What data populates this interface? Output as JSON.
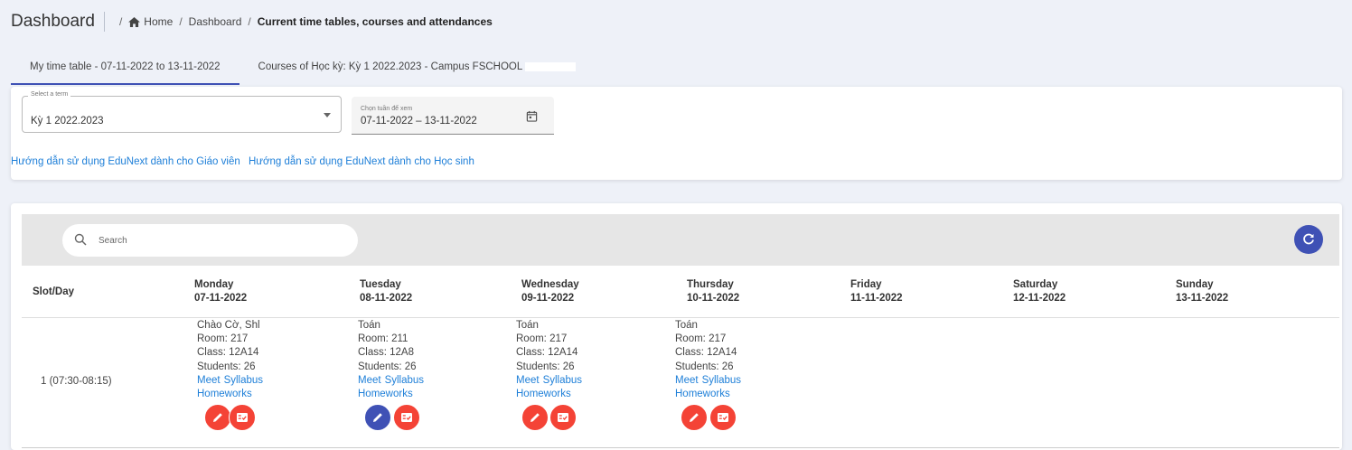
{
  "header": {
    "title": "Dashboard",
    "breadcrumb": {
      "home": "Home",
      "dashboard": "Dashboard",
      "current": "Current time tables, courses and attendances"
    }
  },
  "tabs": [
    {
      "label": "My time table - 07-11-2022 to 13-11-2022",
      "active": true
    },
    {
      "label": "Courses of Học kỳ: Kỳ 1 2022.2023 - Campus FSCHOOL",
      "active": false
    }
  ],
  "filters": {
    "term_label": "Select a term",
    "term_value": "Kỳ 1 2022.2023",
    "week_label": "Chọn tuần để xem",
    "week_value": "07-11-2022 – 13-11-2022"
  },
  "links": {
    "teacher_guide": "Hướng dẫn sử dụng EduNext dành cho Giáo viên",
    "student_guide": "Hướng dẫn sử dụng EduNext dành cho Học sinh"
  },
  "search": {
    "placeholder": "Search"
  },
  "timetable": {
    "slot_header": "Slot/Day",
    "days": [
      {
        "name": "Monday",
        "date": "07-11-2022"
      },
      {
        "name": "Tuesday",
        "date": "08-11-2022"
      },
      {
        "name": "Wednesday",
        "date": "09-11-2022"
      },
      {
        "name": "Thursday",
        "date": "10-11-2022"
      },
      {
        "name": "Friday",
        "date": "11-11-2022"
      },
      {
        "name": "Saturday",
        "date": "12-11-2022"
      },
      {
        "name": "Sunday",
        "date": "13-11-2022"
      }
    ],
    "rows": [
      {
        "slot": "1 (07:30-08:15)",
        "cells": [
          {
            "subject": "Chào Cờ, Shl",
            "room": "Room: 217",
            "class": "Class: 12A14",
            "students": "Students: 26",
            "meet": "Meet",
            "syllabus": "Syllabus",
            "homeworks": "Homeworks",
            "edit_color": "#f44336"
          },
          {
            "subject": "Toán",
            "room": "Room: 211",
            "class": "Class: 12A8",
            "students": "Students: 26",
            "meet": "Meet",
            "syllabus": "Syllabus",
            "homeworks": "Homeworks",
            "edit_color": "#3f51b5"
          },
          {
            "subject": "Toán",
            "room": "Room: 217",
            "class": "Class: 12A14",
            "students": "Students: 26",
            "meet": "Meet",
            "syllabus": "Syllabus",
            "homeworks": "Homeworks",
            "edit_color": "#f44336"
          },
          {
            "subject": "Toán",
            "room": "Room: 217",
            "class": "Class: 12A14",
            "students": "Students: 26",
            "meet": "Meet",
            "syllabus": "Syllabus",
            "homeworks": "Homeworks",
            "edit_color": "#f44336"
          }
        ]
      }
    ]
  },
  "colors": {
    "accent": "#3f51b5",
    "danger": "#f44336",
    "link": "#1e7fd8"
  }
}
